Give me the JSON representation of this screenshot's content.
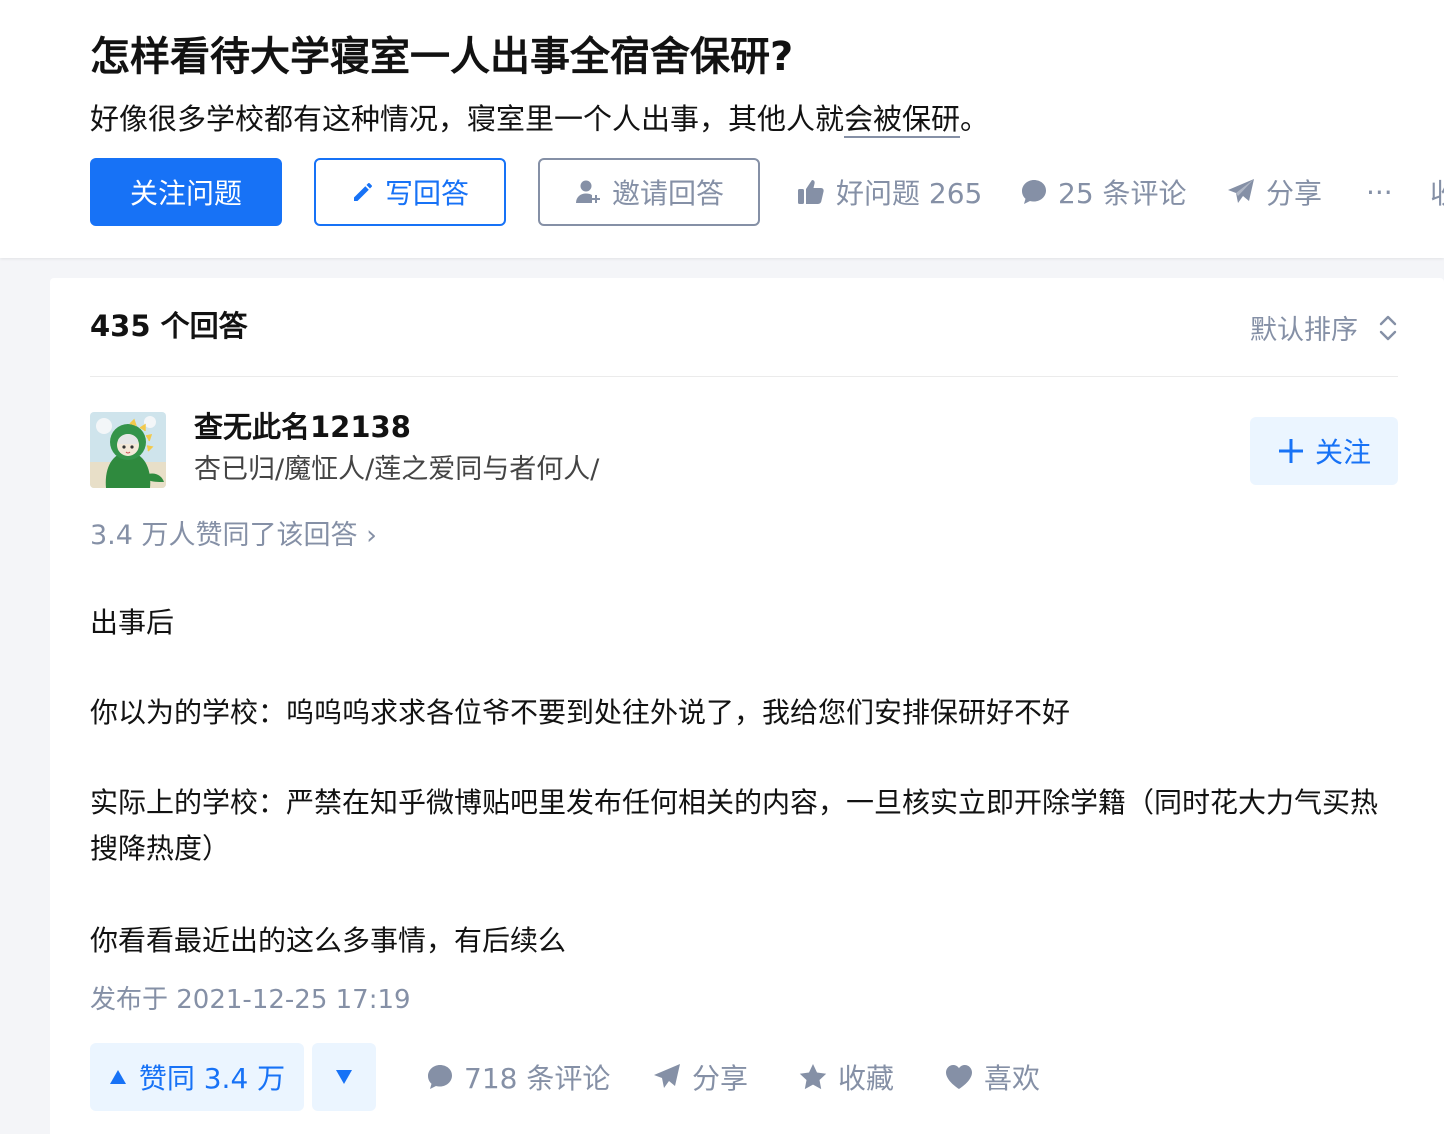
{
  "question": {
    "title": "怎样看待大学寝室一人出事全宿舍保研?",
    "detail_prefix": "好像很多学校都有这种情况，寝室里一个人出事，其他人就",
    "detail_underlined": "会被保研",
    "detail_suffix": "。",
    "follow_label": "关注问题",
    "write_label": "写回答",
    "invite_label": "邀请回答",
    "good_question_label": "好问题 265",
    "comments_label": "25 条评论",
    "share_label": "分享",
    "more_label": "···",
    "clipped_label": "收"
  },
  "answers": {
    "count_label": "435 个回答",
    "sort_label": "默认排序"
  },
  "answer": {
    "author": {
      "name": "查无此名12138",
      "bio": "杏已归/魔怔人/莲之爱同与者何人/",
      "follow_label": "关注"
    },
    "voters_label": "3.4 万人赞同了该回答",
    "voters_chevron": "›",
    "paragraphs": [
      "出事后",
      "你以为的学校：呜呜呜求求各位爷不要到处往外说了，我给您们安排保研好不好",
      "实际上的学校：严禁在知乎微博贴吧里发布任何相关的内容，一旦核实立即开除学籍（同时花大力气买热搜降热度）",
      "你看看最近出的这么多事情，有后续么"
    ],
    "published": "发布于 2021-12-25 17:19",
    "upvote_label": "赞同 3.4 万",
    "comments_label": "718 条评论",
    "share_label": "分享",
    "favorite_label": "收藏",
    "like_label": "喜欢"
  },
  "colors": {
    "brand": "#1772f6",
    "muted": "#8590a6",
    "brand_light": "#ebf5ff"
  }
}
